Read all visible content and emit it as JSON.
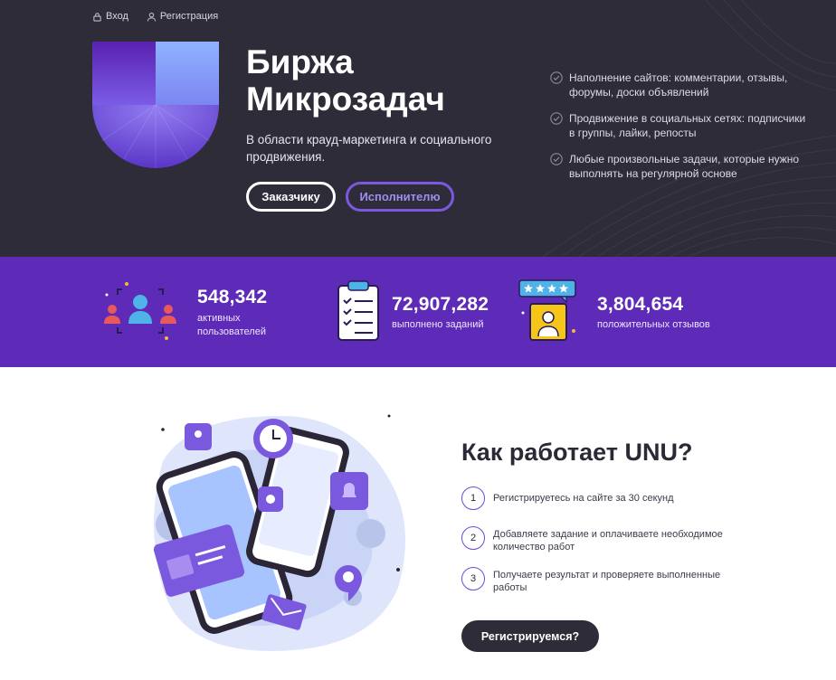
{
  "topnav": {
    "login": "Вход",
    "register": "Регистрация"
  },
  "hero": {
    "title_line1": "Биржа",
    "title_line2": "Микрозадач",
    "subtitle": "В области крауд-маркетинга и социального продвижения.",
    "btn_customer": "Заказчику",
    "btn_worker": "Исполнителю"
  },
  "features": [
    {
      "text": "Наполнение сайтов: комментарии, отзывы, форумы, доски объявлений"
    },
    {
      "text": "Продвижение в социальных сетях: подписчики в группы, лайки, репосты"
    },
    {
      "text": "Любые произвольные задачи, которые нужно выполнять на регулярной основе"
    }
  ],
  "stats": [
    {
      "value": "548,342",
      "label": "активных пользователей"
    },
    {
      "value": "72,907,282",
      "label": "выполнено заданий"
    },
    {
      "value": "3,804,654",
      "label": "положительных отзывов"
    }
  ],
  "how": {
    "title": "Как работает UNU?",
    "steps": [
      {
        "num": "1",
        "text": "Регистрируетесь на сайте за 30 секунд"
      },
      {
        "num": "2",
        "text": "Добавляете задание и оплачиваете необходимое количество работ"
      },
      {
        "num": "3",
        "text": "Получаете результат и проверяете выполненные работы"
      }
    ],
    "cta": "Регистрируемся?"
  },
  "colors": {
    "hero_bg": "#2d2c38",
    "stats_bg": "#5e2ab8",
    "accent": "#6f49d6",
    "cta_bg": "#2d2c38"
  },
  "icons": [
    "lock-icon",
    "user-icon",
    "check-circle-icon",
    "users-icon",
    "clipboard-icon",
    "rating-icon",
    "unu-logo"
  ]
}
